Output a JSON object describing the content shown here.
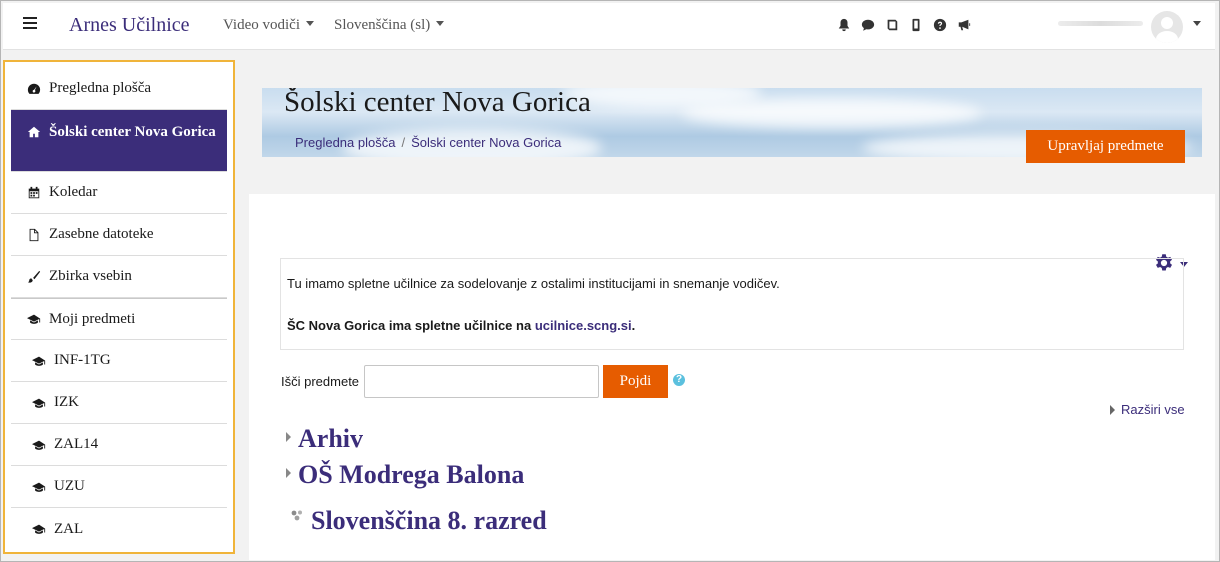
{
  "navbar": {
    "brand": "Arnes Učilnice",
    "menus": [
      {
        "label": "Video vodiči"
      },
      {
        "label": "Slovenščina (sl)"
      }
    ],
    "icons": [
      "bell-icon",
      "chat-icon",
      "book-icon",
      "mobile-icon",
      "help-icon",
      "megaphone-icon"
    ]
  },
  "sidebar": {
    "items": [
      {
        "label": "Pregledna plošča",
        "icon": "dashboard-icon"
      },
      {
        "label": "Šolski center Nova Gorica",
        "icon": "home-icon",
        "active": true
      },
      {
        "label": "Koledar",
        "icon": "calendar-icon"
      },
      {
        "label": "Zasebne datoteke",
        "icon": "file-icon"
      },
      {
        "label": "Zbirka vsebin",
        "icon": "brush-icon"
      },
      {
        "label": "Moji predmeti",
        "icon": "graduation-cap-icon"
      },
      {
        "label": "INF-1TG",
        "icon": "graduation-cap-icon"
      },
      {
        "label": "IZK",
        "icon": "graduation-cap-icon"
      },
      {
        "label": "ZAL14",
        "icon": "graduation-cap-icon"
      },
      {
        "label": "UZU",
        "icon": "graduation-cap-icon"
      },
      {
        "label": "ZAL",
        "icon": "graduation-cap-icon"
      }
    ]
  },
  "header": {
    "title": "Šolski center Nova Gorica",
    "breadcrumb": [
      "Pregledna plošča",
      "Šolski center Nova Gorica"
    ],
    "manage_button": "Upravljaj predmete"
  },
  "main": {
    "info_line1": "Tu imamo spletne učilnice za sodelovanje z ostalimi institucijami in snemanje vodičev.",
    "info_line2_prefix": "ŠC Nova Gorica ima spletne učilnice na ",
    "info_link": "ucilnice.scng.si",
    "info_line2_suffix": ".",
    "search_label": "Išči predmete",
    "search_value": "",
    "search_button": "Pojdi",
    "help_glyph": "?",
    "expand_all": "Razširi vse",
    "categories": [
      {
        "label": "Arhiv"
      },
      {
        "label": "OŠ Modrega Balona"
      }
    ],
    "course": {
      "label": "Slovenščina 8. razred"
    }
  },
  "colors": {
    "brand": "#3b2d7a",
    "accent": "#e65c00",
    "sidebar_highlight": "#f0b43a"
  }
}
